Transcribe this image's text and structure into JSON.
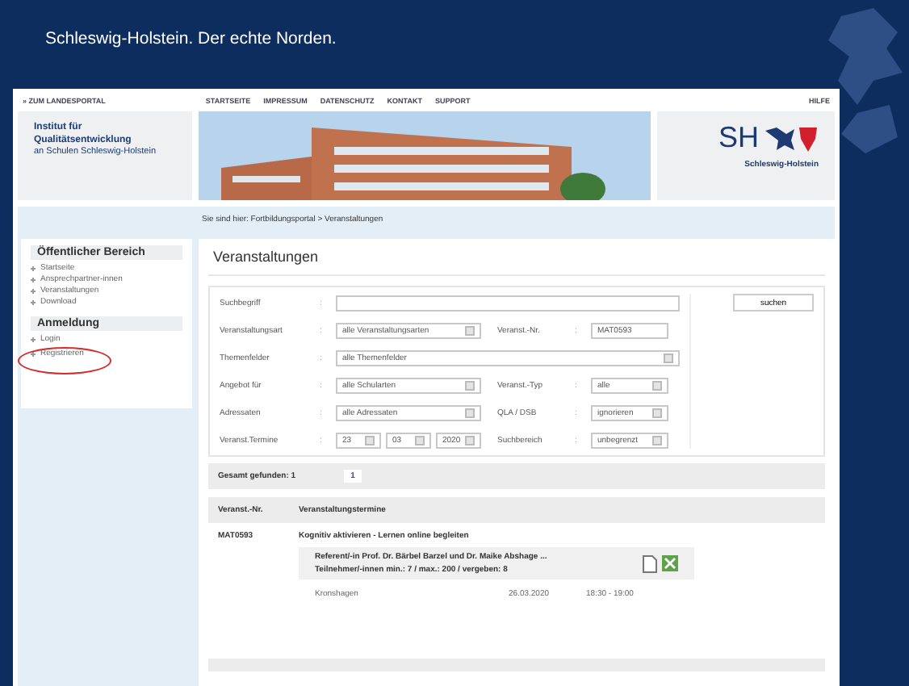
{
  "banner": {
    "title": "Schleswig-Holstein. Der echte Norden."
  },
  "topnav": {
    "portal_link": "» ZUM LANDESPORTAL",
    "links": [
      "STARTSEITE",
      "IMPRESSUM",
      "DATENSCHUTZ",
      "KONTAKT",
      "SUPPORT"
    ],
    "help": "HILFE"
  },
  "institute": {
    "name": "Institut für Qualitätsentwicklung",
    "sub": "an Schulen Schleswig-Holstein"
  },
  "logo": {
    "letters": "SH",
    "caption": "Schleswig-Holstein"
  },
  "breadcrumb": "Sie sind hier: Fortbildungsportal > Veranstaltungen",
  "sidebar": [
    {
      "heading": "Öffentlicher Bereich",
      "items": [
        {
          "label": "Startseite",
          "circled": false
        },
        {
          "label": "Ansprechpartner-innen",
          "circled": false
        },
        {
          "label": "Veranstaltungen",
          "circled": false
        },
        {
          "label": "Download",
          "circled": false
        }
      ]
    },
    {
      "heading": "Anmeldung",
      "items": [
        {
          "label": "Login",
          "circled": false
        },
        {
          "label": "Registrieren",
          "circled": true
        }
      ]
    }
  ],
  "page_title": "Veranstaltungen",
  "form": {
    "rows": [
      [
        {
          "label": "Suchbegriff",
          "separator": ":",
          "kind": "text"
        }
      ],
      [
        {
          "label": "Veranstaltungsart",
          "separator": ":",
          "kind": "select",
          "value": "alle Veranstaltungsarten"
        },
        {
          "label": "Veranst.-Nr.",
          "separator": ":",
          "kind": "text",
          "value": "MAT0593"
        }
      ],
      [
        {
          "label": "Themenfelder",
          "separator": ":",
          "kind": "select",
          "value": "alle Themenfelder"
        }
      ],
      [
        {
          "label": "Angebot für",
          "separator": ":",
          "kind": "select",
          "value": "alle Schularten"
        },
        {
          "label": "Veranst.-Typ",
          "separator": ":",
          "kind": "select",
          "value": "alle"
        }
      ],
      [
        {
          "label": "Adressaten",
          "separator": ":",
          "kind": "select",
          "value": "alle Adressaten"
        },
        {
          "label": "QLA / DSB",
          "separator": ":",
          "kind": "select",
          "value": "ignorieren"
        }
      ],
      [
        {
          "label": "Veranst.Termine",
          "separator": ":",
          "kind": "date",
          "parts": [
            "23",
            "03",
            "2020"
          ]
        },
        {
          "label": "Suchbereich",
          "separator": ":",
          "kind": "select",
          "value": "unbegrenzt"
        }
      ]
    ],
    "button": "suchen"
  },
  "results": {
    "total": "Gesamt gefunden: 1",
    "pages": [
      {
        "label": "1",
        "selected": true
      }
    ],
    "columns": [
      "Veranst.-Nr.",
      "Veranstaltungstermine"
    ],
    "rows": [
      {
        "number": "MAT0593",
        "title": "Kognitiv aktivieren - Lernen online begleiten",
        "speakers": "Referent/-in Prof. Dr. Bärbel Barzel und Dr. Maike Abshage ...",
        "participants": "Teilnehmer/-innen min.: 7 / max.: 200 / vergeben: 8",
        "place": "Kronshagen",
        "date": "26.03.2020",
        "time": "18:30 - 19:00"
      }
    ]
  }
}
